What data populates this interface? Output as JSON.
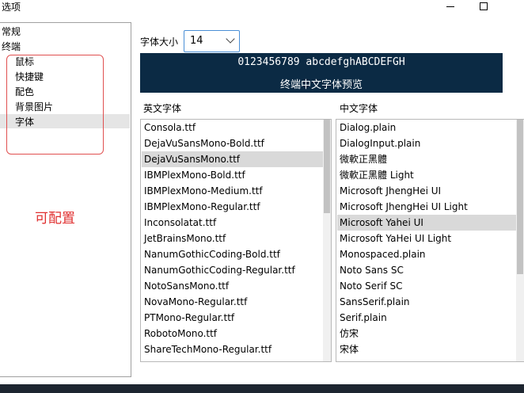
{
  "window": {
    "title": "选项",
    "minimize_icon": "minimize-icon",
    "maximize_icon": "maximize-icon"
  },
  "sidebar": {
    "items": [
      {
        "label": "常规"
      },
      {
        "label": "终端"
      },
      {
        "label": "鼠标"
      },
      {
        "label": "快捷键"
      },
      {
        "label": "配色"
      },
      {
        "label": "背景图片"
      },
      {
        "label": "字体",
        "selected": true
      }
    ],
    "annotation": "可配置",
    "annotation_color": "#e03030"
  },
  "font_size": {
    "label": "字体大小",
    "value": "14"
  },
  "preview": {
    "latin": "0123456789 abcdefghABCDEFGH",
    "chinese": "终端中文字体预览",
    "background": "#0b2a44"
  },
  "english_fonts": {
    "label": "英文字体",
    "items": [
      "Consola.ttf",
      "DejaVuSansMono-Bold.ttf",
      "DejaVuSansMono.ttf",
      "IBMPlexMono-Bold.ttf",
      "IBMPlexMono-Medium.ttf",
      "IBMPlexMono-Regular.ttf",
      "Inconsolatat.ttf",
      "JetBrainsMono.ttf",
      "NanumGothicCoding-Bold.ttf",
      "NanumGothicCoding-Regular.ttf",
      "NotoSansMono.ttf",
      "NovaMono-Regular.ttf",
      "PTMono-Regular.ttf",
      "RobotoMono.ttf",
      "ShareTechMono-Regular.ttf"
    ],
    "selected": "DejaVuSansMono.ttf"
  },
  "chinese_fonts": {
    "label": "中文字体",
    "items": [
      "Dialog.plain",
      "DialogInput.plain",
      "微軟正黑體",
      "微軟正黑體 Light",
      "Microsoft JhengHei UI",
      "Microsoft JhengHei UI Light",
      "Microsoft Yahei UI",
      "Microsoft YaHei UI Light",
      "Monospaced.plain",
      "Noto Sans SC",
      "Noto Serif SC",
      "SansSerif.plain",
      "Serif.plain",
      "仿宋",
      "宋体"
    ],
    "selected": "Microsoft Yahei UI"
  }
}
